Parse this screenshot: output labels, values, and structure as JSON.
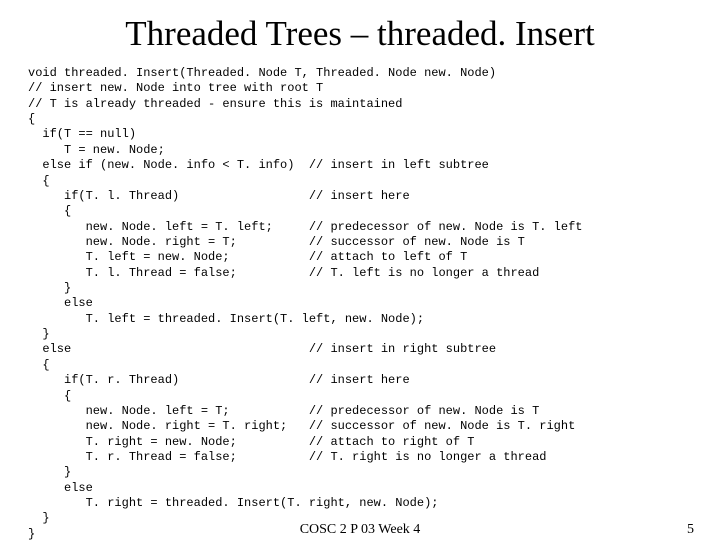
{
  "title": "Threaded Trees – threaded. Insert",
  "code_lines": [
    "void threaded. Insert(Threaded. Node T, Threaded. Node new. Node)",
    "// insert new. Node into tree with root T",
    "// T is already threaded - ensure this is maintained",
    "{",
    "  if(T == null)",
    "     T = new. Node;",
    "  else if (new. Node. info < T. info)  // insert in left subtree",
    "  {",
    "     if(T. l. Thread)                  // insert here",
    "     {",
    "        new. Node. left = T. left;     // predecessor of new. Node is T. left",
    "        new. Node. right = T;          // successor of new. Node is T",
    "        T. left = new. Node;           // attach to left of T",
    "        T. l. Thread = false;          // T. left is no longer a thread",
    "     }",
    "     else",
    "        T. left = threaded. Insert(T. left, new. Node);",
    "  }",
    "  else                                 // insert in right subtree",
    "  {",
    "     if(T. r. Thread)                  // insert here",
    "     {",
    "        new. Node. left = T;           // predecessor of new. Node is T",
    "        new. Node. right = T. right;   // successor of new. Node is T. right",
    "        T. right = new. Node;          // attach to right of T",
    "        T. r. Thread = false;          // T. right is no longer a thread",
    "     }",
    "     else",
    "        T. right = threaded. Insert(T. right, new. Node);",
    "  }",
    "}"
  ],
  "footer": {
    "center": "COSC 2 P 03 Week 4",
    "page": "5"
  }
}
